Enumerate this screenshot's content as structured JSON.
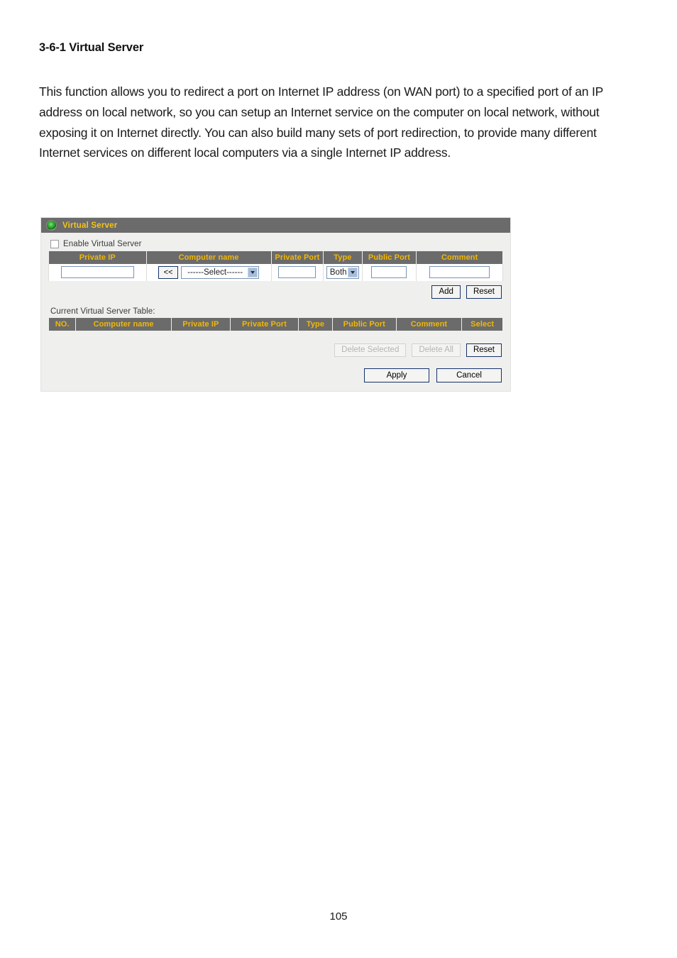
{
  "document": {
    "heading": "3-6-1 Virtual Server",
    "paragraph": "This function allows you to redirect a port on Internet IP address (on WAN port) to a specified port of an IP address on local network, so you can setup an Internet service on the computer on local network, without exposing it on Internet directly. You can also build many sets of port redirection, to provide many different Internet services on different local computers via a single Internet IP address.",
    "page_number": "105"
  },
  "panel": {
    "title": "Virtual Server",
    "title_icon": "green-status-dot-icon",
    "title_color": "#f5c518",
    "titlebar_color": "#6b6b6b",
    "body_color": "#efefed",
    "enable_checkbox": {
      "label": "Enable Virtual Server",
      "checked": false
    },
    "entry_form": {
      "headers": [
        "Private IP",
        "Computer name",
        "Private Port",
        "Type",
        "Public Port",
        "Comment"
      ],
      "fields": {
        "private_ip": {
          "value": "",
          "placeholder": ""
        },
        "computer_name_button": "<<",
        "computer_name_select": "------Select------",
        "private_port": {
          "value": "",
          "placeholder": ""
        },
        "type_select": "Both",
        "public_port": {
          "value": "",
          "placeholder": ""
        },
        "comment": {
          "value": "",
          "placeholder": ""
        }
      },
      "buttons": {
        "add": "Add",
        "reset": "Reset"
      }
    },
    "current_table": {
      "label": "Current Virtual Server Table:",
      "headers": [
        "NO.",
        "Computer name",
        "Private IP",
        "Private Port",
        "Type",
        "Public Port",
        "Comment",
        "Select"
      ],
      "rows": [],
      "buttons": {
        "delete_selected": {
          "label": "Delete Selected",
          "disabled": true
        },
        "delete_all": {
          "label": "Delete All",
          "disabled": true
        },
        "reset": {
          "label": "Reset",
          "disabled": false
        }
      }
    },
    "footer_buttons": {
      "apply": "Apply",
      "cancel": "Cancel"
    }
  }
}
